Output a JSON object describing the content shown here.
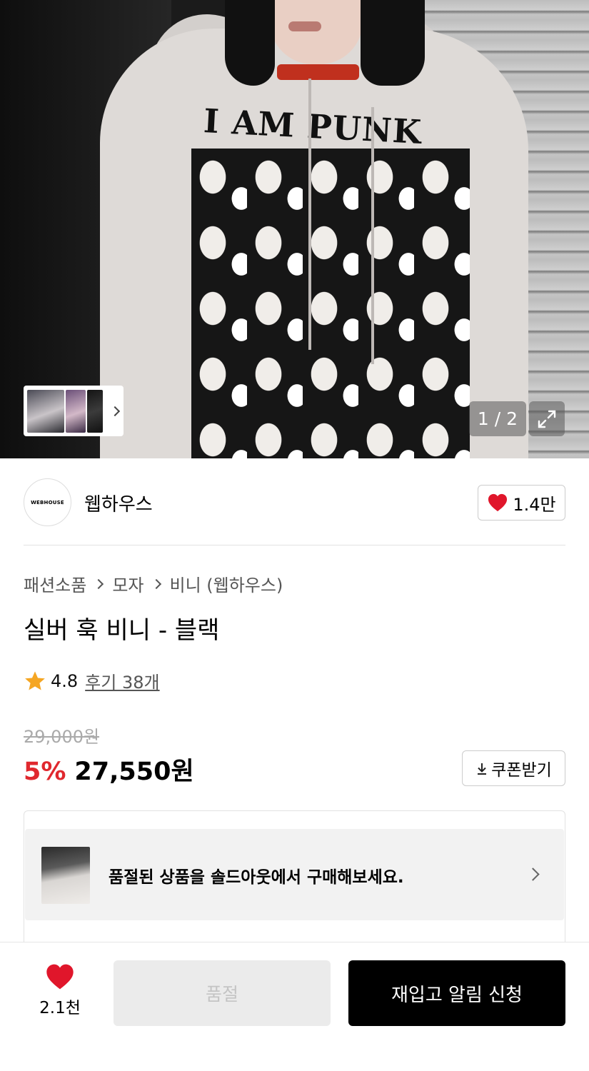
{
  "gallery": {
    "counter": "1 / 2",
    "thumbnails": [
      "thumb-1",
      "thumb-2",
      "thumb-3"
    ],
    "print_title": "I AM PUNK"
  },
  "brand": {
    "logo_text": "WEBHOUSE",
    "name": "웹하우스",
    "likes": "1.4만"
  },
  "product": {
    "breadcrumb": [
      "패션소품",
      "모자",
      "비니 (웹하우스)"
    ],
    "title": "실버 훅 비니 - 블랙",
    "rating": "4.8",
    "reviews": "후기 38개",
    "original_price": "29,000원",
    "discount": "5%",
    "price": "27,550원",
    "coupon_label": "쿠폰받기"
  },
  "notice": {
    "text": "품절된 상품을 솔드아웃에서 구매해보세요."
  },
  "bottom_bar": {
    "wish_count": "2.1천",
    "soldout_label": "품절",
    "restock_label": "재입고 알림 신청"
  },
  "colors": {
    "accent_red": "#e0282e",
    "heart_red": "#e0162b",
    "star": "#f5a623",
    "primary_button": "#000000"
  }
}
